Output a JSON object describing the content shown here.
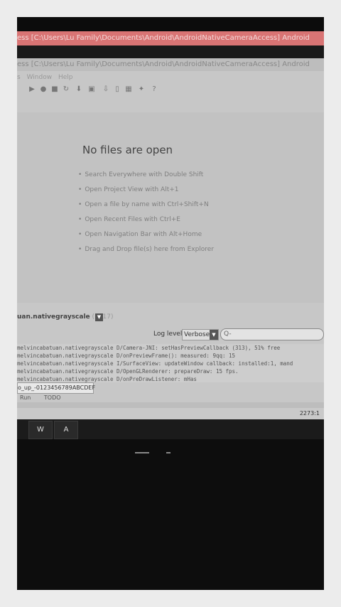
{
  "window": {
    "title_top": "ess [C:\\Users\\Lu Family\\Documents\\Android\\AndroidNativeCameraAccess] Android",
    "title_second": "ess [C:\\Users\\Lu Family\\Documents\\Android\\AndroidNativeCameraAccess] Android"
  },
  "menu": [
    "s",
    "Window",
    "Help"
  ],
  "toolbar_icons": [
    "run-icon",
    "debug-icon",
    "stop-icon",
    "sync-icon",
    "sdk-icon",
    "avd-icon",
    "build-icon",
    "device-icon",
    "layout-icon",
    "help-icon"
  ],
  "editor": {
    "empty_title": "No files are open",
    "tips": [
      "Search Everywhere with Double Shift",
      "Open Project View with Alt+1",
      "Open a file by name with Ctrl+Shift+N",
      "Open Recent Files with Ctrl+E",
      "Open Navigation Bar with Alt+Home",
      "Drag and Drop file(s) here from Explorer"
    ]
  },
  "logcat": {
    "process": "uan.nativegrayscale",
    "pid": "(1317)",
    "level_label": "Log level:",
    "level_value": "Verbose",
    "search_placeholder": "Q-",
    "lines": [
      "melvincabatuan.nativegrayscale D/Camera-JNI: setHasPreviewCallback (313), 51% free",
      "melvincabatuan.nativegrayscale D/onPreviewFrame(): measured: 9qq: 15",
      "melvincabatuan.nativegrayscale I/SurfaceView: updateWindow callback: installed:1, mand",
      "melvincabatuan.nativegrayscale D/OpenGLRenderer: prepareDraw: 15 fps.",
      "melvincabatuan.nativegrayscale D/onPreDrawListener: mHas"
    ]
  },
  "bottom": {
    "device_row": "o_up_-0123456789ABCDEF",
    "tab_run": "Run",
    "tab_todo": "TODO",
    "position": "2273:1"
  },
  "taskbar": {
    "word_label": "W",
    "app_label": "A"
  }
}
